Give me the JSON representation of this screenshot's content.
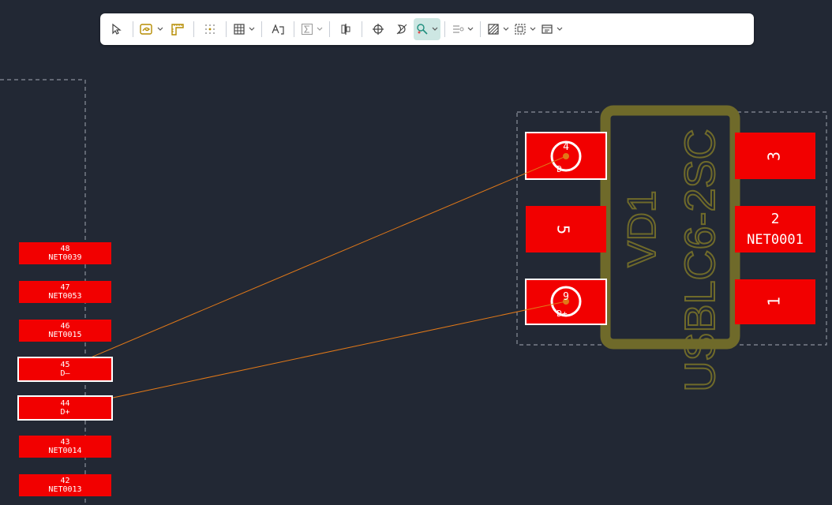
{
  "toolbar": {
    "buttons": [
      {
        "name": "select-tool-button",
        "icon": "cursor-arrow-icon",
        "dropdown": false
      },
      {
        "name": "route-track-button",
        "icon": "route-track-icon",
        "dropdown": true
      },
      {
        "name": "ruler-button",
        "icon": "ruler-icon",
        "dropdown": false
      },
      {
        "name": "grid-dots-button",
        "icon": "grid-dots-icon",
        "dropdown": false
      },
      {
        "name": "table-button",
        "icon": "table-icon",
        "dropdown": true
      },
      {
        "name": "text-tool-button",
        "icon": "text-icon",
        "dropdown": false
      },
      {
        "name": "sigma-button",
        "icon": "sigma-icon",
        "dropdown": true
      },
      {
        "name": "align-button",
        "icon": "align-icon",
        "dropdown": false
      },
      {
        "name": "crosshair-button",
        "icon": "crosshair-icon",
        "dropdown": false
      },
      {
        "name": "flip-button",
        "icon": "flip-icon",
        "dropdown": false
      },
      {
        "name": "highlight-net-button",
        "icon": "highlight-net-icon",
        "dropdown": true,
        "active": true
      },
      {
        "name": "layers-button",
        "icon": "layers-icon",
        "dropdown": true
      },
      {
        "name": "fill-button",
        "icon": "hatch-fill-icon",
        "dropdown": true
      },
      {
        "name": "board-outline-button",
        "icon": "board-outline-icon",
        "dropdown": true
      },
      {
        "name": "view-button",
        "icon": "view-icon",
        "dropdown": true
      }
    ]
  },
  "connector_pins": [
    {
      "number": "48",
      "net": "NET0039",
      "selected": false
    },
    {
      "number": "47",
      "net": "NET0053",
      "selected": false
    },
    {
      "number": "46",
      "net": "NET0015",
      "selected": false
    },
    {
      "number": "45",
      "net": "D–",
      "selected": true
    },
    {
      "number": "44",
      "net": "D+",
      "selected": true
    },
    {
      "number": "43",
      "net": "NET0014",
      "selected": false
    },
    {
      "number": "42",
      "net": "NET0013",
      "selected": false
    }
  ],
  "component": {
    "designator": "VD1",
    "part_name": "USBLC6-2SC",
    "pads_left": [
      {
        "number": "4",
        "net": "D–",
        "selected": true
      },
      {
        "number": "5",
        "net": "",
        "selected": false
      },
      {
        "number": "6",
        "net": "D+",
        "selected": true
      }
    ],
    "pads_right": [
      {
        "number": "3",
        "net": ""
      },
      {
        "number": "2",
        "net": "NET0001"
      },
      {
        "number": "1",
        "net": ""
      }
    ]
  },
  "colors": {
    "background": "#222834",
    "pad": "#f20000",
    "silkscreen": "#6f6a2a",
    "ratsnest": "#e07818",
    "outline": "#8a8f9a"
  }
}
